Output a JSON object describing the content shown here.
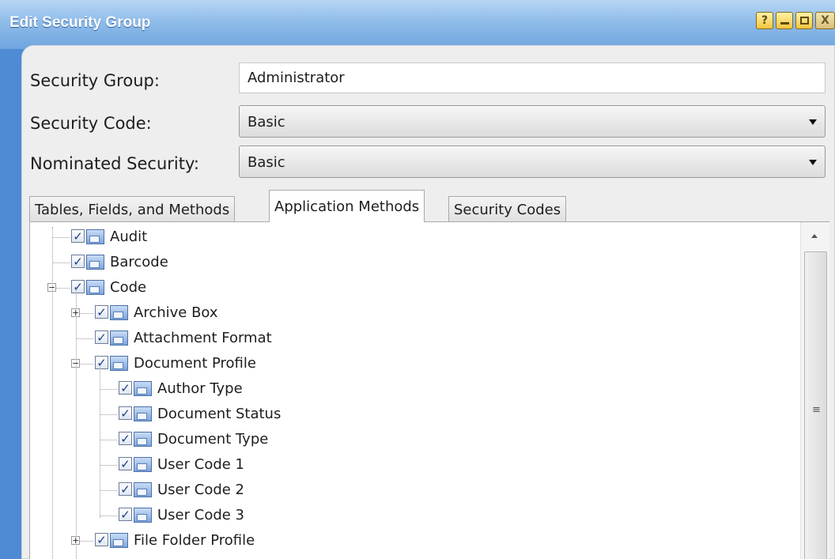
{
  "window": {
    "title": "Edit Security Group",
    "buttons": {
      "help": "?",
      "close": "X"
    }
  },
  "form": {
    "security_group_label": "Security Group:",
    "security_group_value": "Administrator",
    "security_code_label": "Security Code:",
    "security_code_value": "Basic",
    "nominated_security_label": "Nominated Security:",
    "nominated_security_value": "Basic"
  },
  "tabs": [
    {
      "label": "Tables, Fields, and Methods",
      "active": false
    },
    {
      "label": "Application Methods",
      "active": true
    },
    {
      "label": "Security Codes",
      "active": false
    }
  ],
  "tree": [
    {
      "label": "Audit",
      "level": 0,
      "checked": true
    },
    {
      "label": "Barcode",
      "level": 0,
      "checked": true
    },
    {
      "label": "Code",
      "level": 0,
      "checked": true,
      "expander": "minus"
    },
    {
      "label": "Archive Box",
      "level": 1,
      "checked": true,
      "expander": "plus"
    },
    {
      "label": "Attachment Format",
      "level": 1,
      "checked": true
    },
    {
      "label": "Document Profile",
      "level": 1,
      "checked": true,
      "expander": "minus"
    },
    {
      "label": "Author Type",
      "level": 2,
      "checked": true
    },
    {
      "label": "Document Status",
      "level": 2,
      "checked": true
    },
    {
      "label": "Document Type",
      "level": 2,
      "checked": true
    },
    {
      "label": "User Code 1",
      "level": 2,
      "checked": true
    },
    {
      "label": "User Code 2",
      "level": 2,
      "checked": true
    },
    {
      "label": "User Code 3",
      "level": 2,
      "checked": true
    },
    {
      "label": "File Folder Profile",
      "level": 1,
      "checked": true,
      "expander": "plus"
    }
  ],
  "icons": {
    "checkbox_checked": "checkmark-icon",
    "node": "application-method-icon",
    "expand": "plus-box-icon",
    "collapse": "minus-box-icon"
  },
  "colors": {
    "title_bar": "#8fbce9",
    "panel_bg": "#eeeeee",
    "window_frame": "#4e8bd4"
  }
}
